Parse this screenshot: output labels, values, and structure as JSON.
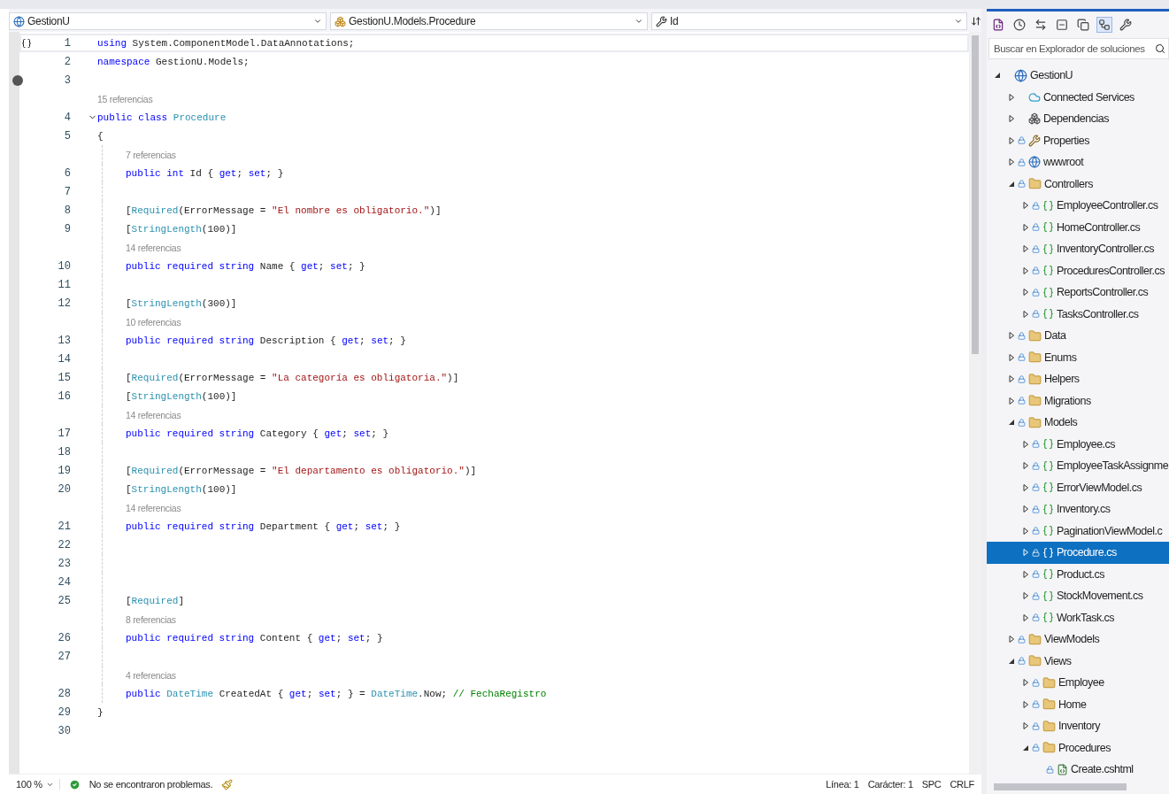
{
  "editor": {
    "nav": [
      {
        "kind": "project",
        "label": "GestionU"
      },
      {
        "kind": "class",
        "label": "GestionU.Models.Procedure"
      },
      {
        "kind": "member",
        "label": "Id"
      }
    ],
    "rows": [
      {
        "kind": "code",
        "n": "1",
        "indent": false,
        "current": true,
        "fold": false,
        "breakpoint": false,
        "t": [
          {
            "kind": "kw",
            "text": "using"
          },
          {
            "kind": "plain",
            "text": " System.ComponentModel.DataAnnotations;"
          }
        ]
      },
      {
        "kind": "code",
        "n": "2",
        "indent": false,
        "current": false,
        "fold": false,
        "breakpoint": false,
        "t": [
          {
            "kind": "kw",
            "text": "namespace"
          },
          {
            "kind": "plain",
            "text": " GestionU.Models;"
          }
        ]
      },
      {
        "kind": "code",
        "n": "3",
        "indent": false,
        "current": false,
        "fold": false,
        "breakpoint": true
      },
      {
        "kind": "lens",
        "indent": false,
        "text": "15 referencias"
      },
      {
        "kind": "code",
        "n": "4",
        "indent": false,
        "current": false,
        "fold": true,
        "breakpoint": false,
        "t": [
          {
            "kind": "kw",
            "text": "public class"
          },
          {
            "kind": "type",
            "text": " Procedure"
          }
        ]
      },
      {
        "kind": "code",
        "n": "5",
        "indent": false,
        "current": false,
        "fold": false,
        "breakpoint": false,
        "t": [
          {
            "kind": "plain",
            "text": "{"
          }
        ]
      },
      {
        "kind": "lens",
        "indent": true,
        "text": "7 referencias"
      },
      {
        "kind": "code",
        "n": "6",
        "indent": true,
        "current": false,
        "fold": false,
        "breakpoint": false,
        "t": [
          {
            "kind": "kw",
            "text": "public int"
          },
          {
            "kind": "plain",
            "text": " Id { "
          },
          {
            "kind": "kw",
            "text": "get"
          },
          {
            "kind": "plain",
            "text": "; "
          },
          {
            "kind": "kw",
            "text": "set"
          },
          {
            "kind": "plain",
            "text": "; }"
          }
        ]
      },
      {
        "kind": "code",
        "n": "7",
        "indent": true,
        "current": false,
        "fold": false,
        "breakpoint": false
      },
      {
        "kind": "code",
        "n": "8",
        "indent": true,
        "current": false,
        "fold": false,
        "breakpoint": false,
        "t": [
          {
            "kind": "plain",
            "text": "["
          },
          {
            "kind": "type",
            "text": "Required"
          },
          {
            "kind": "plain",
            "text": "(ErrorMessage = "
          },
          {
            "kind": "str",
            "text": "\"El nombre es obligatorio.\""
          },
          {
            "kind": "plain",
            "text": ")]"
          }
        ]
      },
      {
        "kind": "code",
        "n": "9",
        "indent": true,
        "current": false,
        "fold": false,
        "breakpoint": false,
        "t": [
          {
            "kind": "plain",
            "text": "["
          },
          {
            "kind": "type",
            "text": "StringLength"
          },
          {
            "kind": "plain",
            "text": "(100)]"
          }
        ]
      },
      {
        "kind": "lens",
        "indent": true,
        "text": "14 referencias"
      },
      {
        "kind": "code",
        "n": "10",
        "indent": true,
        "current": false,
        "fold": false,
        "breakpoint": false,
        "t": [
          {
            "kind": "kw",
            "text": "public required string"
          },
          {
            "kind": "plain",
            "text": " Name { "
          },
          {
            "kind": "kw",
            "text": "get"
          },
          {
            "kind": "plain",
            "text": "; "
          },
          {
            "kind": "kw",
            "text": "set"
          },
          {
            "kind": "plain",
            "text": "; }"
          }
        ]
      },
      {
        "kind": "code",
        "n": "11",
        "indent": true,
        "current": false,
        "fold": false,
        "breakpoint": false
      },
      {
        "kind": "code",
        "n": "12",
        "indent": true,
        "current": false,
        "fold": false,
        "breakpoint": false,
        "t": [
          {
            "kind": "plain",
            "text": "["
          },
          {
            "kind": "type",
            "text": "StringLength"
          },
          {
            "kind": "plain",
            "text": "(300)]"
          }
        ]
      },
      {
        "kind": "lens",
        "indent": true,
        "text": "10 referencias"
      },
      {
        "kind": "code",
        "n": "13",
        "indent": true,
        "current": false,
        "fold": false,
        "breakpoint": false,
        "t": [
          {
            "kind": "kw",
            "text": "public required string"
          },
          {
            "kind": "plain",
            "text": " Description { "
          },
          {
            "kind": "kw",
            "text": "get"
          },
          {
            "kind": "plain",
            "text": "; "
          },
          {
            "kind": "kw",
            "text": "set"
          },
          {
            "kind": "plain",
            "text": "; }"
          }
        ]
      },
      {
        "kind": "code",
        "n": "14",
        "indent": true,
        "current": false,
        "fold": false,
        "breakpoint": false
      },
      {
        "kind": "code",
        "n": "15",
        "indent": true,
        "current": false,
        "fold": false,
        "breakpoint": false,
        "t": [
          {
            "kind": "plain",
            "text": "["
          },
          {
            "kind": "type",
            "text": "Required"
          },
          {
            "kind": "plain",
            "text": "(ErrorMessage = "
          },
          {
            "kind": "str",
            "text": "\"La categoría es obligatoria.\""
          },
          {
            "kind": "plain",
            "text": ")]"
          }
        ]
      },
      {
        "kind": "code",
        "n": "16",
        "indent": true,
        "current": false,
        "fold": false,
        "breakpoint": false,
        "t": [
          {
            "kind": "plain",
            "text": "["
          },
          {
            "kind": "type",
            "text": "StringLength"
          },
          {
            "kind": "plain",
            "text": "(100)]"
          }
        ]
      },
      {
        "kind": "lens",
        "indent": true,
        "text": "14 referencias"
      },
      {
        "kind": "code",
        "n": "17",
        "indent": true,
        "current": false,
        "fold": false,
        "breakpoint": false,
        "t": [
          {
            "kind": "kw",
            "text": "public required string"
          },
          {
            "kind": "plain",
            "text": " Category { "
          },
          {
            "kind": "kw",
            "text": "get"
          },
          {
            "kind": "plain",
            "text": "; "
          },
          {
            "kind": "kw",
            "text": "set"
          },
          {
            "kind": "plain",
            "text": "; }"
          }
        ]
      },
      {
        "kind": "code",
        "n": "18",
        "indent": true,
        "current": false,
        "fold": false,
        "breakpoint": false
      },
      {
        "kind": "code",
        "n": "19",
        "indent": true,
        "current": false,
        "fold": false,
        "breakpoint": false,
        "t": [
          {
            "kind": "plain",
            "text": "["
          },
          {
            "kind": "type",
            "text": "Required"
          },
          {
            "kind": "plain",
            "text": "(ErrorMessage = "
          },
          {
            "kind": "str",
            "text": "\"El departamento es obligatorio.\""
          },
          {
            "kind": "plain",
            "text": ")]"
          }
        ]
      },
      {
        "kind": "code",
        "n": "20",
        "indent": true,
        "current": false,
        "fold": false,
        "breakpoint": false,
        "t": [
          {
            "kind": "plain",
            "text": "["
          },
          {
            "kind": "type",
            "text": "StringLength"
          },
          {
            "kind": "plain",
            "text": "(100)]"
          }
        ]
      },
      {
        "kind": "lens",
        "indent": true,
        "text": "14 referencias"
      },
      {
        "kind": "code",
        "n": "21",
        "indent": true,
        "current": false,
        "fold": false,
        "breakpoint": false,
        "t": [
          {
            "kind": "kw",
            "text": "public required string"
          },
          {
            "kind": "plain",
            "text": " Department { "
          },
          {
            "kind": "kw",
            "text": "get"
          },
          {
            "kind": "plain",
            "text": "; "
          },
          {
            "kind": "kw",
            "text": "set"
          },
          {
            "kind": "plain",
            "text": "; }"
          }
        ]
      },
      {
        "kind": "code",
        "n": "22",
        "indent": true,
        "current": false,
        "fold": false,
        "breakpoint": false
      },
      {
        "kind": "code",
        "n": "23",
        "indent": true,
        "current": false,
        "fold": false,
        "breakpoint": false
      },
      {
        "kind": "code",
        "n": "24",
        "indent": true,
        "current": false,
        "fold": false,
        "breakpoint": false
      },
      {
        "kind": "code",
        "n": "25",
        "indent": true,
        "current": false,
        "fold": false,
        "breakpoint": false,
        "t": [
          {
            "kind": "plain",
            "text": "["
          },
          {
            "kind": "type",
            "text": "Required"
          },
          {
            "kind": "plain",
            "text": "]"
          }
        ]
      },
      {
        "kind": "lens",
        "indent": true,
        "text": "8 referencias"
      },
      {
        "kind": "code",
        "n": "26",
        "indent": true,
        "current": false,
        "fold": false,
        "breakpoint": false,
        "t": [
          {
            "kind": "kw",
            "text": "public required string"
          },
          {
            "kind": "plain",
            "text": " Content { "
          },
          {
            "kind": "kw",
            "text": "get"
          },
          {
            "kind": "plain",
            "text": "; "
          },
          {
            "kind": "kw",
            "text": "set"
          },
          {
            "kind": "plain",
            "text": "; }"
          }
        ]
      },
      {
        "kind": "code",
        "n": "27",
        "indent": true,
        "current": false,
        "fold": false,
        "breakpoint": false
      },
      {
        "kind": "lens",
        "indent": true,
        "text": "4 referencias"
      },
      {
        "kind": "code",
        "n": "28",
        "indent": true,
        "current": false,
        "fold": false,
        "breakpoint": false,
        "t": [
          {
            "kind": "kw",
            "text": "public"
          },
          {
            "kind": "type",
            "text": " DateTime"
          },
          {
            "kind": "plain",
            "text": " CreatedAt { "
          },
          {
            "kind": "kw",
            "text": "get"
          },
          {
            "kind": "plain",
            "text": "; "
          },
          {
            "kind": "kw",
            "text": "set"
          },
          {
            "kind": "plain",
            "text": "; } = "
          },
          {
            "kind": "type",
            "text": "DateTime"
          },
          {
            "kind": "plain",
            "text": ".Now; "
          },
          {
            "kind": "comment",
            "text": "// FechaRegistro"
          }
        ]
      },
      {
        "kind": "code",
        "n": "29",
        "indent": false,
        "current": false,
        "fold": false,
        "breakpoint": false,
        "t": [
          {
            "kind": "plain",
            "text": "}"
          }
        ]
      },
      {
        "kind": "code",
        "n": "30",
        "indent": false,
        "current": false,
        "fold": false,
        "breakpoint": false
      }
    ]
  },
  "explorer": {
    "search": {
      "placeholder": "Buscar en Explorador de soluciones"
    },
    "tree": [
      {
        "kind": "project",
        "label": "GestionU",
        "expanded": true,
        "selected": false,
        "locked": false,
        "children": [
          {
            "kind": "service",
            "label": "Connected Services",
            "expanded": false,
            "selected": false,
            "locked": false
          },
          {
            "kind": "deps",
            "label": "Dependencias",
            "expanded": false,
            "selected": false,
            "locked": false
          },
          {
            "kind": "properties",
            "label": "Properties",
            "expanded": false,
            "selected": false,
            "locked": true
          },
          {
            "kind": "web",
            "label": "wwwroot",
            "expanded": false,
            "selected": false,
            "locked": true
          },
          {
            "kind": "folder",
            "label": "Controllers",
            "expanded": true,
            "selected": false,
            "locked": true,
            "children": [
              {
                "kind": "cs",
                "label": "EmployeeController.cs",
                "expanded": false,
                "selected": false,
                "locked": true
              },
              {
                "kind": "cs",
                "label": "HomeController.cs",
                "expanded": false,
                "selected": false,
                "locked": true
              },
              {
                "kind": "cs",
                "label": "InventoryController.cs",
                "expanded": false,
                "selected": false,
                "locked": true
              },
              {
                "kind": "cs",
                "label": "ProceduresController.cs",
                "expanded": false,
                "selected": false,
                "locked": true
              },
              {
                "kind": "cs",
                "label": "ReportsController.cs",
                "expanded": false,
                "selected": false,
                "locked": true
              },
              {
                "kind": "cs",
                "label": "TasksController.cs",
                "expanded": false,
                "selected": false,
                "locked": true
              }
            ]
          },
          {
            "kind": "folder",
            "label": "Data",
            "expanded": false,
            "selected": false,
            "locked": true
          },
          {
            "kind": "folder",
            "label": "Enums",
            "expanded": false,
            "selected": false,
            "locked": true
          },
          {
            "kind": "folder",
            "label": "Helpers",
            "expanded": false,
            "selected": false,
            "locked": true
          },
          {
            "kind": "folder",
            "label": "Migrations",
            "expanded": false,
            "selected": false,
            "locked": true
          },
          {
            "kind": "folder",
            "label": "Models",
            "expanded": true,
            "selected": false,
            "locked": true,
            "children": [
              {
                "kind": "cs",
                "label": "Employee.cs",
                "expanded": false,
                "selected": false,
                "locked": true
              },
              {
                "kind": "cs",
                "label": "EmployeeTaskAssignme",
                "expanded": false,
                "selected": false,
                "locked": true
              },
              {
                "kind": "cs",
                "label": "ErrorViewModel.cs",
                "expanded": false,
                "selected": false,
                "locked": true
              },
              {
                "kind": "cs",
                "label": "Inventory.cs",
                "expanded": false,
                "selected": false,
                "locked": true
              },
              {
                "kind": "cs",
                "label": "PaginationViewModel.c",
                "expanded": false,
                "selected": false,
                "locked": true
              },
              {
                "kind": "cs",
                "label": "Procedure.cs",
                "expanded": false,
                "selected": true,
                "locked": true
              },
              {
                "kind": "cs",
                "label": "Product.cs",
                "expanded": false,
                "selected": false,
                "locked": true
              },
              {
                "kind": "cs",
                "label": "StockMovement.cs",
                "expanded": false,
                "selected": false,
                "locked": true
              },
              {
                "kind": "cs",
                "label": "WorkTask.cs",
                "expanded": false,
                "selected": false,
                "locked": true
              }
            ]
          },
          {
            "kind": "folder",
            "label": "ViewModels",
            "expanded": false,
            "selected": false,
            "locked": true
          },
          {
            "kind": "folder",
            "label": "Views",
            "expanded": true,
            "selected": false,
            "locked": true,
            "children": [
              {
                "kind": "folder",
                "label": "Employee",
                "expanded": false,
                "selected": false,
                "locked": true
              },
              {
                "kind": "folder",
                "label": "Home",
                "expanded": false,
                "selected": false,
                "locked": true
              },
              {
                "kind": "folder",
                "label": "Inventory",
                "expanded": false,
                "selected": false,
                "locked": true
              },
              {
                "kind": "folder",
                "label": "Procedures",
                "expanded": true,
                "selected": false,
                "locked": true,
                "children": [
                  {
                    "kind": "cshtml",
                    "label": "Create.cshtml",
                    "selected": false,
                    "locked": true
                  }
                ]
              }
            ]
          }
        ]
      }
    ]
  },
  "status": {
    "zoom": "100 %",
    "problems": "No se encontraron problemas.",
    "line": "Línea: 1",
    "column": "Carácter: 1",
    "spacing": "SPC",
    "eol": "CRLF"
  }
}
